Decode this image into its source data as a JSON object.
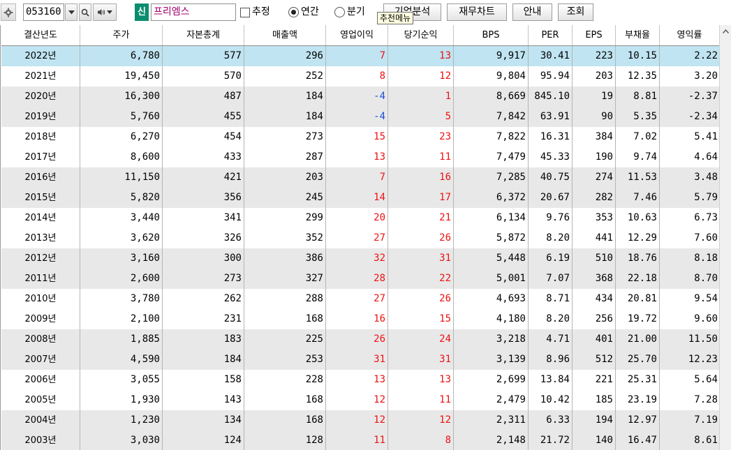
{
  "toolbar": {
    "stock_code": "053160",
    "badge": "신",
    "stock_name": "프리엠스",
    "estimate_label": "추정",
    "annual_label": "연간",
    "quarter_label": "분기",
    "btn_analysis": "기업분석",
    "btn_financial": "재무차트",
    "btn_guide": "안내",
    "btn_query": "조회",
    "tooltip": "추천메뉴",
    "icons": [
      "gear-icon",
      "dropdown-arrow-icon",
      "search-icon",
      "speaker-icon",
      "checkbox-icon",
      "radio-icon"
    ]
  },
  "table": {
    "headers": [
      "결산년도",
      "주가",
      "자본총계",
      "매출액",
      "영업이익",
      "당기순익",
      "BPS",
      "PER",
      "EPS",
      "부채율",
      "영익률"
    ],
    "rows": [
      [
        "2022년",
        "6,780",
        "577",
        "296",
        "7",
        "13",
        "9,917",
        "30.41",
        "223",
        "10.15",
        "2.22"
      ],
      [
        "2021년",
        "19,450",
        "570",
        "252",
        "8",
        "12",
        "9,804",
        "95.94",
        "203",
        "12.35",
        "3.20"
      ],
      [
        "2020년",
        "16,300",
        "487",
        "184",
        "-4",
        "1",
        "8,669",
        "845.10",
        "19",
        "8.81",
        "-2.37"
      ],
      [
        "2019년",
        "5,760",
        "455",
        "184",
        "-4",
        "5",
        "7,842",
        "63.91",
        "90",
        "5.35",
        "-2.34"
      ],
      [
        "2018년",
        "6,270",
        "454",
        "273",
        "15",
        "23",
        "7,822",
        "16.31",
        "384",
        "7.02",
        "5.41"
      ],
      [
        "2017년",
        "8,600",
        "433",
        "287",
        "13",
        "11",
        "7,479",
        "45.33",
        "190",
        "9.74",
        "4.64"
      ],
      [
        "2016년",
        "11,150",
        "421",
        "203",
        "7",
        "16",
        "7,285",
        "40.75",
        "274",
        "11.53",
        "3.48"
      ],
      [
        "2015년",
        "5,820",
        "356",
        "245",
        "14",
        "17",
        "6,372",
        "20.67",
        "282",
        "7.46",
        "5.79"
      ],
      [
        "2014년",
        "3,440",
        "341",
        "299",
        "20",
        "21",
        "6,134",
        "9.76",
        "353",
        "10.63",
        "6.73"
      ],
      [
        "2013년",
        "3,620",
        "326",
        "352",
        "27",
        "26",
        "5,872",
        "8.20",
        "441",
        "12.29",
        "7.60"
      ],
      [
        "2012년",
        "3,160",
        "300",
        "386",
        "32",
        "31",
        "5,448",
        "6.19",
        "510",
        "18.76",
        "8.18"
      ],
      [
        "2011년",
        "2,600",
        "273",
        "327",
        "28",
        "22",
        "5,001",
        "7.07",
        "368",
        "22.18",
        "8.70"
      ],
      [
        "2010년",
        "3,780",
        "262",
        "288",
        "27",
        "26",
        "4,693",
        "8.71",
        "434",
        "20.81",
        "9.54"
      ],
      [
        "2009년",
        "2,100",
        "231",
        "168",
        "16",
        "15",
        "4,180",
        "8.20",
        "256",
        "19.72",
        "9.60"
      ],
      [
        "2008년",
        "1,885",
        "183",
        "225",
        "26",
        "24",
        "3,218",
        "4.71",
        "401",
        "21.00",
        "11.50"
      ],
      [
        "2007년",
        "4,590",
        "184",
        "253",
        "31",
        "31",
        "3,139",
        "8.96",
        "512",
        "25.70",
        "12.23"
      ],
      [
        "2006년",
        "3,055",
        "158",
        "228",
        "13",
        "13",
        "2,699",
        "13.84",
        "221",
        "25.31",
        "5.64"
      ],
      [
        "2005년",
        "1,930",
        "143",
        "168",
        "12",
        "11",
        "2,479",
        "10.42",
        "185",
        "23.19",
        "7.28"
      ],
      [
        "2004년",
        "1,230",
        "134",
        "168",
        "12",
        "12",
        "2,311",
        "6.33",
        "194",
        "12.97",
        "7.19"
      ],
      [
        "2003년",
        "3,030",
        "124",
        "128",
        "11",
        "8",
        "2,148",
        "21.72",
        "140",
        "16.47",
        "8.61"
      ]
    ],
    "row_shading": [
      "sel",
      "",
      "alt",
      "alt",
      "",
      "",
      "alt",
      "alt",
      "",
      "",
      "alt",
      "alt",
      "",
      "",
      "alt",
      "alt",
      "",
      "",
      "alt",
      "alt"
    ]
  },
  "colors": {
    "positive": "#ee1111",
    "negative": "#1a4fd6",
    "selected_row": "#c0e4f1",
    "alt_row": "#e8e8e8",
    "badge": "#0a8d6e",
    "stock_name": "#a0006e"
  }
}
